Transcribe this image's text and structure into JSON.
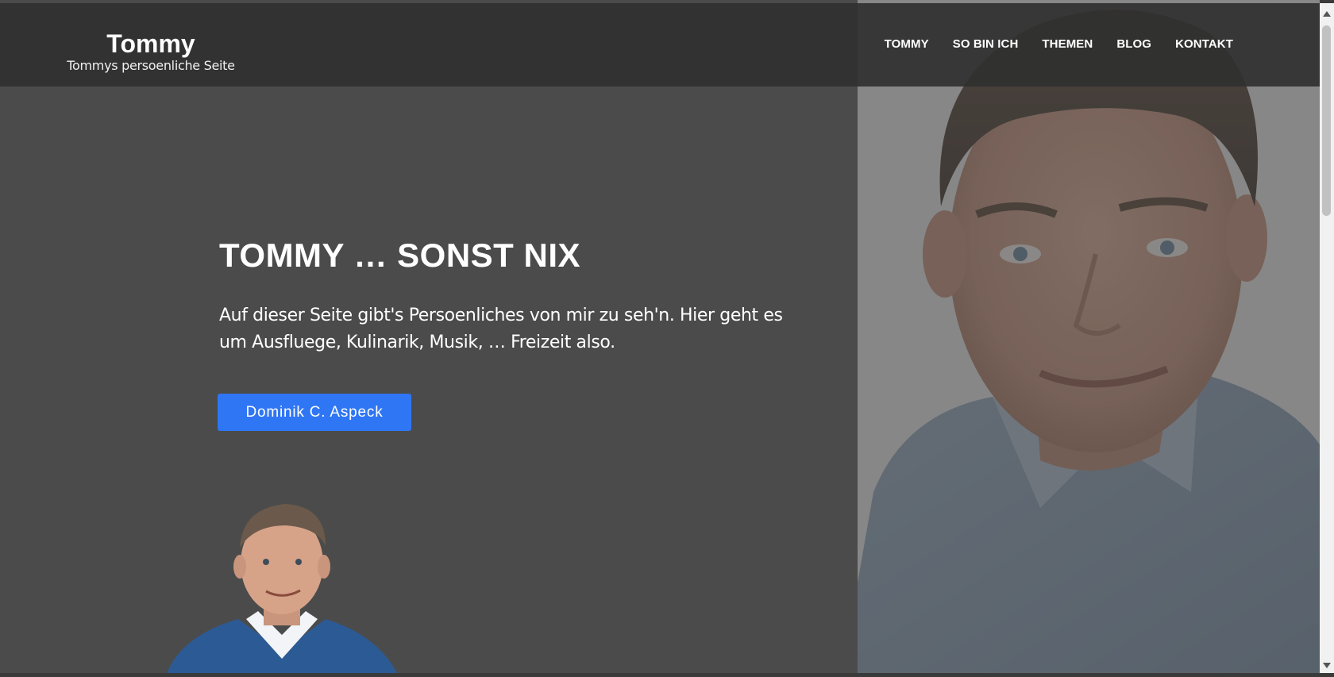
{
  "header": {
    "site_title": "Tommy",
    "tagline": "Tommys persoenliche Seite",
    "nav": [
      {
        "label": "TOMMY"
      },
      {
        "label": "SO BIN ICH"
      },
      {
        "label": "THEMEN"
      },
      {
        "label": "BLOG"
      },
      {
        "label": "KONTAKT"
      }
    ]
  },
  "hero": {
    "title": "TOMMY … SONST NIX",
    "text": "Auf dieser Seite gibt's Persoenliches von mir zu seh'n. Hier geht es um Ausfluege, Kulinarik, Musik, … Freizeit also.",
    "button_label": "Dominik C. Aspeck"
  },
  "colors": {
    "page_background": "#4b4b4b",
    "header_background": "#303030",
    "button_accent": "#2f76f5",
    "text": "#ffffff"
  },
  "icons": {
    "scroll_up": "chevron-up-icon",
    "scroll_down": "chevron-down-icon"
  }
}
